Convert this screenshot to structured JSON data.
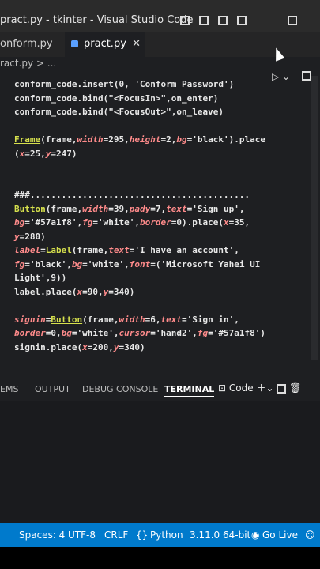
{
  "window": {
    "title": "pract.py - tkinter - Visual Studio Code"
  },
  "tabs": [
    {
      "label": "onform.py",
      "active": false
    },
    {
      "label": "pract.py",
      "active": true,
      "close": "✕"
    }
  ],
  "breadcrumb": "ract.py > ...",
  "code_lines": [
    "conform_code.insert(0, 'Conform Password')",
    "conform_code.bind(\"<FocusIn>\",on_enter)",
    "conform_code.bind(\"<FocusOut>\",on_leave)",
    "",
    "Frame(frame,width=295,height=2,bg='black').place",
    "(x=25,y=247)",
    "",
    "",
    "###..........................................",
    "Button(frame,width=39,pady=7,text='Sign up',",
    "bg='#57a1f8',fg='white',border=0).place(x=35,",
    "y=280)",
    "label=Label(frame,text='I have an account',",
    "fg='black',bg='white',font=('Microsoft Yahei UI",
    "Light',9))",
    "label.place(x=90,y=340)",
    "",
    "signin=Button(frame,width=6,text='Sign in',",
    "border=0,bg='white',cursor='hand2',fg='#57a1f8')",
    "signin.place(x=200,y=340)"
  ],
  "panel": {
    "tabs": [
      "EMS",
      "OUTPUT",
      "DEBUG CONSOLE",
      "TERMINAL"
    ],
    "active_tab": "TERMINAL",
    "terminal_profile": "Code"
  },
  "statusbar": {
    "spaces": "Spaces: 4",
    "encoding": "UTF-8",
    "eol": "CRLF",
    "language": "Python",
    "interpreter": "3.11.0 64-bit",
    "golive": "Go Live"
  },
  "colors": {
    "statusbar": "#007acc",
    "editor_bg": "#1e1f22",
    "accent": "#5aa0ff"
  }
}
